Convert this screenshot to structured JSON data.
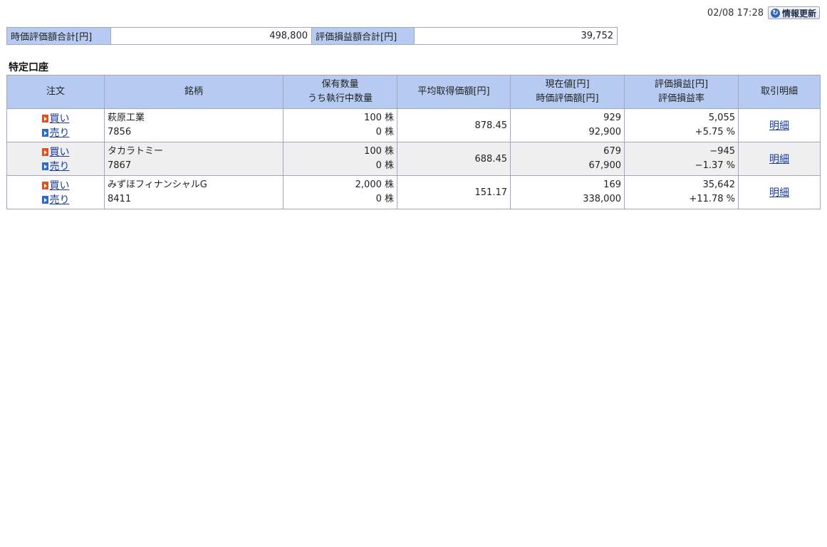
{
  "header": {
    "timestamp": "02/08 17:28",
    "refresh_label": "情報更新",
    "refresh_icon": "refresh-icon"
  },
  "summary": {
    "market_value_label": "時価評価額合計[円]",
    "market_value": "498,800",
    "pl_label": "評価損益額合計[円]",
    "pl_value": "39,752"
  },
  "section": {
    "title": "特定口座"
  },
  "table": {
    "headers": {
      "order": "注文",
      "name": "銘柄",
      "qty_line1": "保有数量",
      "qty_line2": "うち執行中数量",
      "avg_price": "平均取得価額[円]",
      "price_line1": "現在値[円]",
      "price_line2": "時価評価額[円]",
      "pl_line1": "評価損益[円]",
      "pl_line2": "評価損益率",
      "detail": "取引明細"
    },
    "buy_label": "買い",
    "sell_label": "売り",
    "detail_label": "明細",
    "rows": [
      {
        "name": "萩原工業",
        "code": "7856",
        "qty": "100 株",
        "pending_qty": "0 株",
        "avg_price": "878.45",
        "current_price": "929",
        "market_value": "92,900",
        "pl": "5,055",
        "pl_rate": "+5.75 %"
      },
      {
        "name": "タカラトミー",
        "code": "7867",
        "qty": "100 株",
        "pending_qty": "0 株",
        "avg_price": "688.45",
        "current_price": "679",
        "market_value": "67,900",
        "pl": "−945",
        "pl_rate": "−1.37 %"
      },
      {
        "name": "みずほフィナンシャルG",
        "code": "8411",
        "qty": "2,000 株",
        "pending_qty": "0 株",
        "avg_price": "151.17",
        "current_price": "169",
        "market_value": "338,000",
        "pl": "35,642",
        "pl_rate": "+11.78 %"
      }
    ]
  },
  "colors": {
    "header_bg": "#b7cbf2",
    "border": "#9fa8bd",
    "alt_row_bg": "#efefef",
    "buy_arrow": "#e2501f",
    "sell_arrow": "#2a6dc9",
    "link": "#1a3a9c"
  }
}
